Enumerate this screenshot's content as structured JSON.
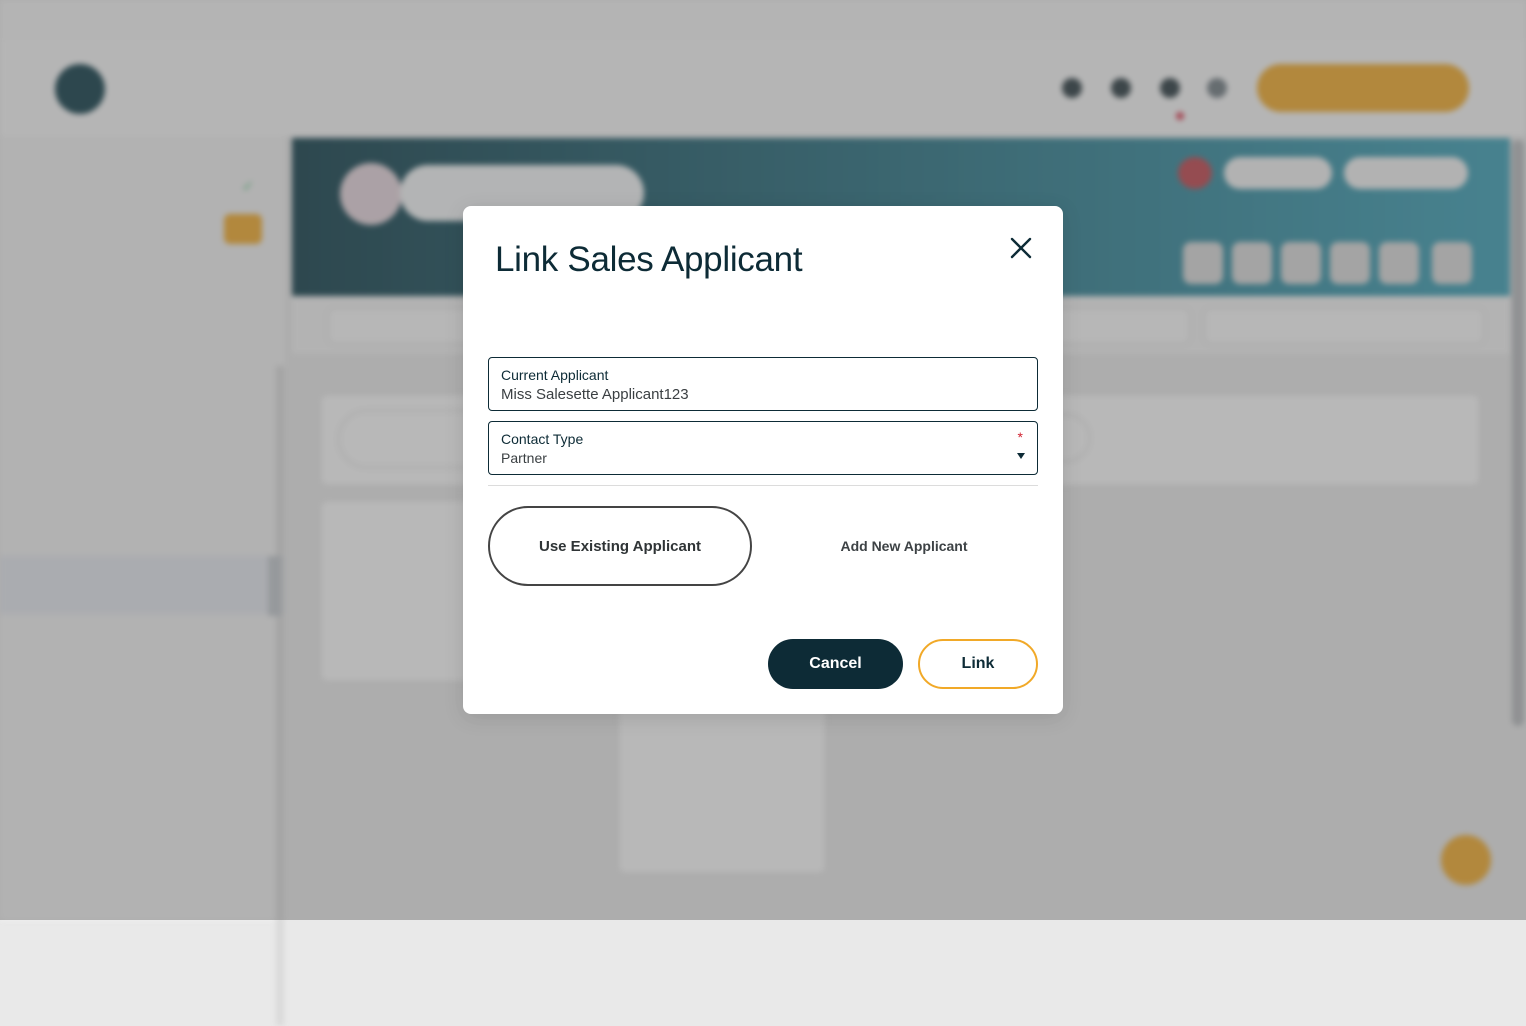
{
  "utility_bar": {
    "items": [
      "",
      "",
      "",
      ""
    ]
  },
  "header": {
    "nav": [
      "",
      "",
      "",
      "",
      "",
      ""
    ],
    "my_account_label": ""
  },
  "sidebar": {
    "meta": [
      "",
      "",
      "",
      ""
    ],
    "items": [
      "",
      "",
      "",
      "",
      "",
      "",
      "",
      "",
      "",
      "",
      ""
    ]
  },
  "modal": {
    "title": "Link Sales Applicant",
    "current_applicant": {
      "label": "Current Applicant",
      "value": "Miss Salesette Applicant123"
    },
    "contact_type": {
      "label": "Contact Type",
      "required_mark": "*",
      "value": "Partner"
    },
    "tabs": {
      "existing": "Use Existing Applicant",
      "new": "Add New Applicant"
    },
    "buttons": {
      "cancel": "Cancel",
      "link": "Link"
    }
  },
  "colors": {
    "primary_dark": "#0d2b36",
    "accent": "#f1a928",
    "required": "#d1202f"
  },
  "icons": {
    "close": "close-icon",
    "caret": "chevron-down-icon"
  }
}
